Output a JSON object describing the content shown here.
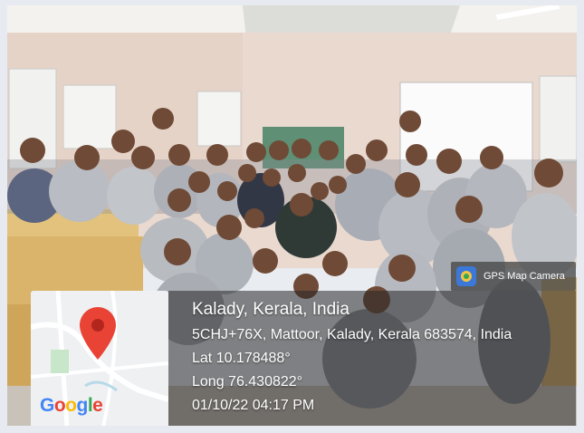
{
  "badge": {
    "label": "GPS Map Camera",
    "icon": "gps-camera-app-icon"
  },
  "location": {
    "title": "Kalady, Kerala, India",
    "address": "5CHJ+76X, Mattoor, Kalady, Kerala 683574, India",
    "lat": "Lat 10.178488°",
    "long": "Long 76.430822°",
    "datetime": "01/10/22 04:17 PM"
  },
  "map": {
    "icon": "map-pin-icon",
    "brand": [
      "G",
      "o",
      "o",
      "g",
      "l",
      "e"
    ]
  },
  "colors": {
    "pin": "#e94335",
    "overlay": "#282828",
    "map_bg": "#eef0f2"
  }
}
